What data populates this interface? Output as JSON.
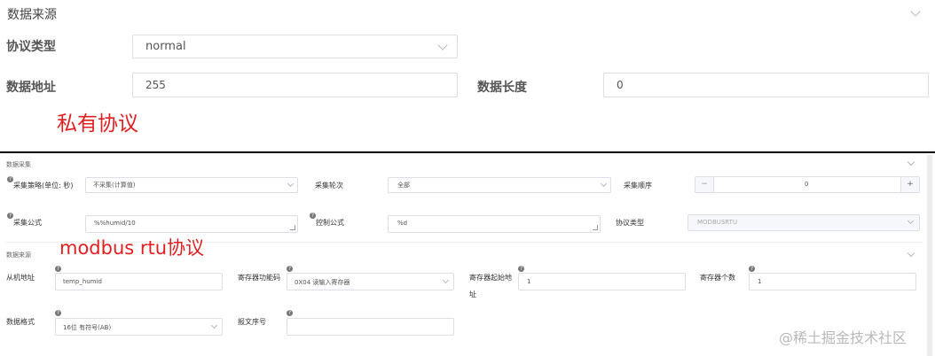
{
  "top": {
    "section_title": "数据来源",
    "protocol_type": {
      "label": "协议类型",
      "value": "normal"
    },
    "data_address": {
      "label": "数据地址",
      "value": "255"
    },
    "data_length": {
      "label": "数据长度",
      "value": "0"
    },
    "annotation": "私有协议"
  },
  "bottom": {
    "collect_section_title": "数据采集",
    "collect_strategy": {
      "label": "采集策略(单位: 秒)",
      "value": "不采集(计算值)"
    },
    "collect_round": {
      "label": "采集轮次",
      "value": "全部"
    },
    "collect_order": {
      "label": "采集顺序",
      "value": "0",
      "minus": "−",
      "plus": "+"
    },
    "collect_formula": {
      "label": "采集公式",
      "value": "%%humid/10"
    },
    "control_formula": {
      "label": "控制公式",
      "value": "%d"
    },
    "protocol_type": {
      "label": "协议类型",
      "value": "MODBUSRTU"
    },
    "source_section_title": "数据来源",
    "annotation": "modbus rtu协议",
    "slave_address": {
      "label": "从机地址",
      "value": "temp_humid"
    },
    "register_function": {
      "label": "寄存器功能码",
      "value": "0X04 读输入寄存器"
    },
    "register_start": {
      "label_line1": "寄存器起始地",
      "label_line2": "址",
      "value": "1"
    },
    "register_count": {
      "label": "寄存器个数",
      "value": "1"
    },
    "data_format": {
      "label": "数据格式",
      "value": "16位 有符号(AB)"
    },
    "message_seq": {
      "label": "报文序号",
      "value": ""
    },
    "help_mark": "?"
  },
  "watermark": "@稀土掘金技术社区",
  "colors": {
    "annotation": "#e02020",
    "border": "#dcdfe6",
    "disabled_bg": "#f5f7fa",
    "divider": "#000000"
  }
}
